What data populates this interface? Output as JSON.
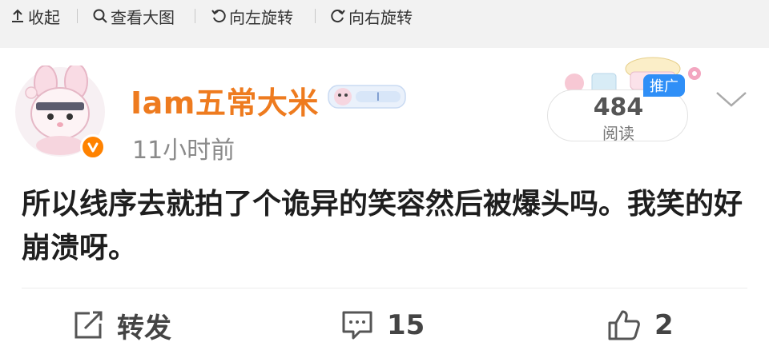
{
  "toolbar": {
    "collapse": "收起",
    "view_large": "查看大图",
    "rotate_left": "向左旋转",
    "rotate_right": "向右旋转"
  },
  "post": {
    "username": "Iam五常大米",
    "time": "11小时前",
    "reads_count": "484",
    "reads_label": "阅读",
    "promo_tag": "推广",
    "content": "所以线序去就拍了个诡异的笑容然后被爆头吗。我笑的好崩溃呀。"
  },
  "actions": {
    "repost_label": "转发",
    "comment_count": "15",
    "like_count": "2"
  },
  "colors": {
    "username": "#ee7b1f",
    "verified_badge": "#ff8200",
    "promo_tag": "#2f8ff7"
  },
  "icons": [
    "collapse-arrow-icon",
    "search-icon",
    "rotate-left-icon",
    "rotate-right-icon",
    "verified-icon",
    "chevron-down-icon",
    "repost-icon",
    "comment-icon",
    "like-icon"
  ]
}
